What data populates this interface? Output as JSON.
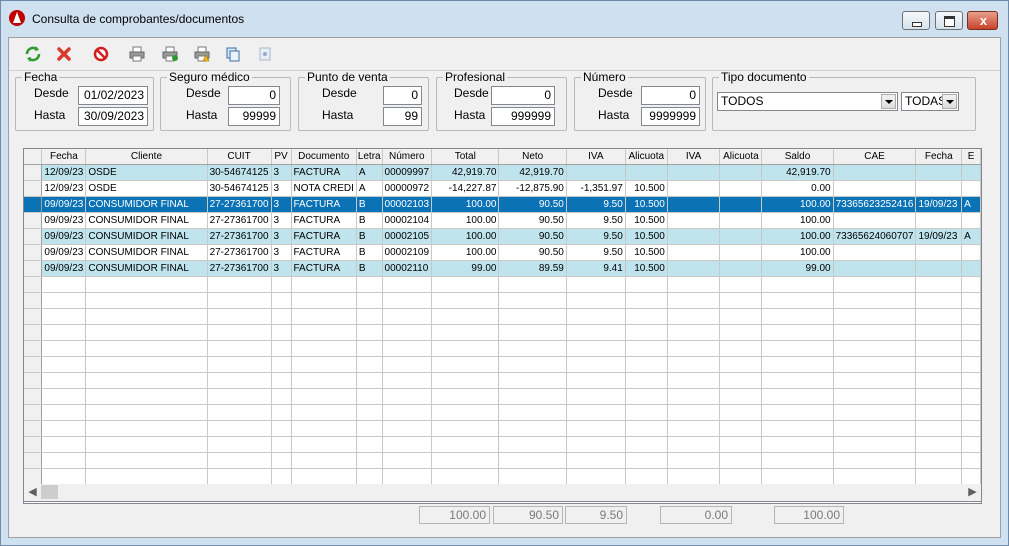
{
  "window": {
    "title": "Consulta de comprobantes/documentos",
    "close_label": "x"
  },
  "toolbar": {
    "icons": [
      "refresh-icon",
      "delete-icon",
      "cancel-icon",
      "print-icon",
      "print-add-icon",
      "print-warning-icon",
      "copy-icon",
      "document-icon"
    ]
  },
  "filters": {
    "fecha": {
      "legend": "Fecha",
      "desde_label": "Desde",
      "hasta_label": "Hasta",
      "desde": "01/02/2023",
      "hasta": "30/09/2023"
    },
    "seguro": {
      "legend": "Seguro médico",
      "desde_label": "Desde",
      "hasta_label": "Hasta",
      "desde": "0",
      "hasta": "99999"
    },
    "punto": {
      "legend": "Punto de venta",
      "desde_label": "Desde",
      "hasta_label": "Hasta",
      "desde": "0",
      "hasta": "99"
    },
    "profesional": {
      "legend": "Profesional",
      "desde_label": "Desde",
      "hasta_label": "Hasta",
      "desde": "0",
      "hasta": "999999"
    },
    "numero": {
      "legend": "Número",
      "desde_label": "Desde",
      "hasta_label": "Hasta",
      "desde": "0",
      "hasta": "9999999"
    },
    "tipo": {
      "legend": "Tipo documento",
      "tipo_value": "TODOS",
      "letra_value": "TODAS"
    }
  },
  "grid": {
    "columns": [
      "Fecha",
      "Cliente",
      "CUIT",
      "PV",
      "Documento",
      "Letra",
      "Número",
      "Total",
      "Neto",
      "IVA",
      "Alicuota",
      "IVA",
      "Alicuota",
      "Saldo",
      "CAE",
      "Fecha",
      "E"
    ],
    "rows": [
      {
        "cells": [
          "12/09/23",
          "OSDE",
          "30-54674125",
          "3",
          "FACTURA",
          "A",
          "00009997",
          "42,919.70",
          "42,919.70",
          "",
          "",
          "",
          "",
          "42,919.70",
          "",
          "",
          ""
        ],
        "style": "odd"
      },
      {
        "cells": [
          "12/09/23",
          "OSDE",
          "30-54674125",
          "3",
          "NOTA CREDI",
          "A",
          "00000972",
          "-14,227.87",
          "-12,875.90",
          "-1,351.97",
          "10.500",
          "",
          "",
          "0.00",
          "",
          "",
          ""
        ],
        "style": "even"
      },
      {
        "cells": [
          "09/09/23",
          "CONSUMIDOR FINAL",
          "27-27361700",
          "3",
          "FACTURA",
          "B",
          "00002103",
          "100.00",
          "90.50",
          "9.50",
          "10.500",
          "",
          "",
          "100.00",
          "73365623252416",
          "19/09/23",
          "A"
        ],
        "style": "sel"
      },
      {
        "cells": [
          "09/09/23",
          "CONSUMIDOR FINAL",
          "27-27361700",
          "3",
          "FACTURA",
          "B",
          "00002104",
          "100.00",
          "90.50",
          "9.50",
          "10.500",
          "",
          "",
          "100.00",
          "",
          "",
          ""
        ],
        "style": "even"
      },
      {
        "cells": [
          "09/09/23",
          "CONSUMIDOR FINAL",
          "27-27361700",
          "3",
          "FACTURA",
          "B",
          "00002105",
          "100.00",
          "90.50",
          "9.50",
          "10.500",
          "",
          "",
          "100.00",
          "73365624060707",
          "19/09/23",
          "A"
        ],
        "style": "odd"
      },
      {
        "cells": [
          "09/09/23",
          "CONSUMIDOR FINAL",
          "27-27361700",
          "3",
          "FACTURA",
          "B",
          "00002109",
          "100.00",
          "90.50",
          "9.50",
          "10.500",
          "",
          "",
          "100.00",
          "",
          "",
          ""
        ],
        "style": "even"
      },
      {
        "cells": [
          "09/09/23",
          "CONSUMIDOR FINAL",
          "27-27361700",
          "3",
          "FACTURA",
          "B",
          "00002110",
          "99.00",
          "89.59",
          "9.41",
          "10.500",
          "",
          "",
          "99.00",
          "",
          "",
          ""
        ],
        "style": "odd"
      }
    ],
    "empty_rows": 14
  },
  "totals": {
    "total": "100.00",
    "neto": "90.50",
    "iva": "9.50",
    "iva2": "0.00",
    "saldo": "100.00"
  },
  "colors": {
    "selected_row": "#0a72b5",
    "alt_row": "#bfe4ee",
    "titlebar": "#cfe0f1"
  }
}
